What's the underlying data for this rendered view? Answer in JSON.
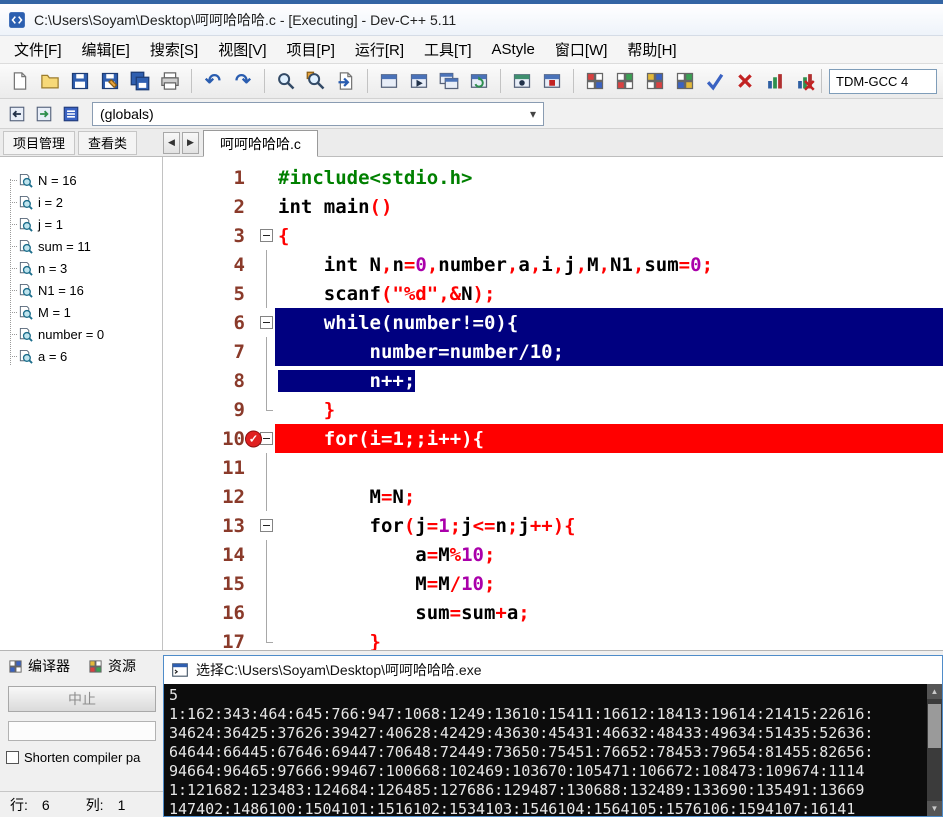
{
  "colors": {
    "accent": "#3465a4",
    "selection": "#000080",
    "breakpoint": "#ff0000",
    "preprocessor": "#008000",
    "symbol": "#ff0000",
    "number": "#aa00aa",
    "string": "#ff0000",
    "line_number": "#8a3a2a",
    "console_text": "#e6e6e6"
  },
  "icons": {
    "chevron": "▾",
    "tab_left": "◀",
    "tab_right": "▶",
    "scroll_up": "▲",
    "scroll_down": "▼",
    "breakpoint_glyph": "✓"
  },
  "window": {
    "title": "C:\\Users\\Soyam\\Desktop\\呵呵哈哈哈.c - [Executing] - Dev-C++ 5.11"
  },
  "menu": [
    "文件[F]",
    "编辑[E]",
    "搜索[S]",
    "视图[V]",
    "项目[P]",
    "运行[R]",
    "工具[T]",
    "AStyle",
    "窗口[W]",
    "帮助[H]"
  ],
  "toolbar": {
    "items": [
      {
        "name": "new-file"
      },
      {
        "name": "open-file"
      },
      {
        "name": "save"
      },
      {
        "name": "save-as"
      },
      {
        "name": "save-all"
      },
      {
        "name": "print"
      },
      {
        "sep": true
      },
      {
        "name": "undo"
      },
      {
        "name": "redo"
      },
      {
        "sep": true
      },
      {
        "name": "find"
      },
      {
        "name": "replace"
      },
      {
        "name": "goto-line"
      },
      {
        "sep": true
      },
      {
        "name": "compile"
      },
      {
        "name": "run"
      },
      {
        "name": "compile-run"
      },
      {
        "name": "rebuild-all"
      },
      {
        "sep": true
      },
      {
        "name": "debug"
      },
      {
        "name": "stop-execution"
      },
      {
        "sep": true
      },
      {
        "name": "new-project"
      },
      {
        "name": "remove-from-project"
      },
      {
        "name": "project-options"
      },
      {
        "name": "window-layout"
      },
      {
        "name": "check-syntax"
      },
      {
        "name": "abort-compilation"
      },
      {
        "name": "profile-analysis"
      },
      {
        "name": "delete-profiling"
      }
    ],
    "compiler": "TDM-GCC 4"
  },
  "nav": {
    "buttons": [
      {
        "name": "goto-back"
      },
      {
        "name": "goto-forward"
      },
      {
        "name": "class-browser"
      }
    ],
    "globals": "(globals)"
  },
  "left": {
    "tabs": [
      {
        "id": "project-manager",
        "label": "项目管理"
      },
      {
        "id": "class-viewer",
        "label": "查看类"
      }
    ],
    "watches": [
      "N = 16",
      "i = 2",
      "j = 1",
      "sum = 11",
      "n = 3",
      "N1 = 16",
      "M = 1",
      "number = 0",
      "a = 6"
    ]
  },
  "editor": {
    "tab": "呵呵哈哈哈.c",
    "lines": [
      {
        "n": "1",
        "fold": "",
        "tokens": [
          [
            "#include<stdio.h>",
            "p"
          ]
        ]
      },
      {
        "n": "2",
        "fold": "",
        "tokens": [
          [
            "int",
            "k"
          ],
          [
            " ",
            "w"
          ],
          [
            "main",
            "i"
          ],
          [
            "()",
            "s"
          ]
        ]
      },
      {
        "n": "3",
        "fold": "box",
        "tokens": [
          [
            "{",
            "s"
          ]
        ]
      },
      {
        "n": "4",
        "fold": "line",
        "tokens": [
          [
            "    ",
            "w"
          ],
          [
            "int",
            "k"
          ],
          [
            " ",
            "w"
          ],
          [
            "N",
            "i"
          ],
          [
            ",",
            "s"
          ],
          [
            "n",
            "i"
          ],
          [
            "=",
            "s"
          ],
          [
            "0",
            "n"
          ],
          [
            ",",
            "s"
          ],
          [
            "number",
            "i"
          ],
          [
            ",",
            "s"
          ],
          [
            "a",
            "i"
          ],
          [
            ",",
            "s"
          ],
          [
            "i",
            "i"
          ],
          [
            ",",
            "s"
          ],
          [
            "j",
            "i"
          ],
          [
            ",",
            "s"
          ],
          [
            "M",
            "i"
          ],
          [
            ",",
            "s"
          ],
          [
            "N1",
            "i"
          ],
          [
            ",",
            "s"
          ],
          [
            "sum",
            "i"
          ],
          [
            "=",
            "s"
          ],
          [
            "0",
            "n"
          ],
          [
            ";",
            "s"
          ]
        ]
      },
      {
        "n": "5",
        "fold": "line",
        "tokens": [
          [
            "    ",
            "w"
          ],
          [
            "scanf",
            "i"
          ],
          [
            "(",
            "s"
          ],
          [
            "\"%d\"",
            "t"
          ],
          [
            ",",
            "s"
          ],
          [
            "&",
            "s"
          ],
          [
            "N",
            "i"
          ],
          [
            ");",
            "s"
          ]
        ]
      },
      {
        "n": "6",
        "fold": "box",
        "state": "sel-line",
        "tokens": [
          [
            "    ",
            "w"
          ],
          [
            "while",
            "k"
          ],
          [
            "(",
            "s"
          ],
          [
            "number",
            "i"
          ],
          [
            "!=",
            "s"
          ],
          [
            "0",
            "n"
          ],
          [
            "){",
            "s"
          ]
        ]
      },
      {
        "n": "7",
        "fold": "line",
        "state": "sel-line",
        "tokens": [
          [
            "        ",
            "w"
          ],
          [
            "number",
            "i"
          ],
          [
            "=",
            "s"
          ],
          [
            "number",
            "i"
          ],
          [
            "/",
            "s"
          ],
          [
            "10",
            "n"
          ],
          [
            ";",
            "s"
          ]
        ]
      },
      {
        "n": "8",
        "fold": "line",
        "state": "sel-text",
        "tokens": [
          [
            "        ",
            "w"
          ],
          [
            "n",
            "i"
          ],
          [
            "++",
            "s"
          ],
          [
            ";",
            "s"
          ]
        ]
      },
      {
        "n": "9",
        "fold": "end",
        "tokens": [
          [
            "    ",
            "w"
          ],
          [
            "}",
            "s"
          ]
        ]
      },
      {
        "n": "10",
        "fold": "box",
        "state": "bp",
        "bp": true,
        "tokens": [
          [
            "    ",
            "w"
          ],
          [
            "for",
            "k"
          ],
          [
            "(",
            "s"
          ],
          [
            "i",
            "i"
          ],
          [
            "=",
            "s"
          ],
          [
            "1",
            "n"
          ],
          [
            ";;",
            "s"
          ],
          [
            "i",
            "i"
          ],
          [
            "++",
            "s"
          ],
          [
            "){",
            "s"
          ]
        ]
      },
      {
        "n": "11",
        "fold": "line",
        "tokens": []
      },
      {
        "n": "12",
        "fold": "line",
        "tokens": [
          [
            "        ",
            "w"
          ],
          [
            "M",
            "i"
          ],
          [
            "=",
            "s"
          ],
          [
            "N",
            "i"
          ],
          [
            ";",
            "s"
          ]
        ]
      },
      {
        "n": "13",
        "fold": "box",
        "tokens": [
          [
            "        ",
            "w"
          ],
          [
            "for",
            "k"
          ],
          [
            "(",
            "s"
          ],
          [
            "j",
            "i"
          ],
          [
            "=",
            "s"
          ],
          [
            "1",
            "n"
          ],
          [
            ";",
            "s"
          ],
          [
            "j",
            "i"
          ],
          [
            "<=",
            "s"
          ],
          [
            "n",
            "i"
          ],
          [
            ";",
            "s"
          ],
          [
            "j",
            "i"
          ],
          [
            "++",
            "s"
          ],
          [
            "){",
            "s"
          ]
        ]
      },
      {
        "n": "14",
        "fold": "line",
        "tokens": [
          [
            "            ",
            "w"
          ],
          [
            "a",
            "i"
          ],
          [
            "=",
            "s"
          ],
          [
            "M",
            "i"
          ],
          [
            "%",
            "s"
          ],
          [
            "10",
            "n"
          ],
          [
            ";",
            "s"
          ]
        ]
      },
      {
        "n": "15",
        "fold": "line",
        "tokens": [
          [
            "            ",
            "w"
          ],
          [
            "M",
            "i"
          ],
          [
            "=",
            "s"
          ],
          [
            "M",
            "i"
          ],
          [
            "/",
            "s"
          ],
          [
            "10",
            "n"
          ],
          [
            ";",
            "s"
          ]
        ]
      },
      {
        "n": "16",
        "fold": "line",
        "tokens": [
          [
            "            ",
            "w"
          ],
          [
            "sum",
            "i"
          ],
          [
            "=",
            "s"
          ],
          [
            "sum",
            "i"
          ],
          [
            "+",
            "s"
          ],
          [
            "a",
            "i"
          ],
          [
            ";",
            "s"
          ]
        ]
      },
      {
        "n": "17",
        "fold": "end",
        "tokens": [
          [
            "        ",
            "w"
          ],
          [
            "}",
            "s"
          ]
        ]
      }
    ]
  },
  "bottom": {
    "tabs": [
      {
        "icon": "compiler-tab",
        "label": "编译器"
      },
      {
        "icon": "resource-tab",
        "label": "资源"
      }
    ],
    "abort": "中止",
    "shorten": "Shorten compiler pa",
    "status": [
      {
        "label": "行:",
        "value": "6"
      },
      {
        "label": "列:",
        "value": "1"
      }
    ]
  },
  "console": {
    "title": "选择C:\\Users\\Soyam\\Desktop\\呵呵哈哈哈.exe",
    "lines": [
      "5",
      "1:162:343:464:645:766:947:1068:1249:13610:15411:16612:18413:19614:21415:22616:",
      "34624:36425:37626:39427:40628:42429:43630:45431:46632:48433:49634:51435:52636:",
      "64644:66445:67646:69447:70648:72449:73650:75451:76652:78453:79654:81455:82656:",
      "94664:96465:97666:99467:100668:102469:103670:105471:106672:108473:109674:1114",
      "1:121682:123483:124684:126485:127686:129487:130688:132489:133690:135491:13669",
      "147402:1486100:1504101:1516102:1534103:1546104:1564105:1576106:1594107:16141"
    ]
  }
}
